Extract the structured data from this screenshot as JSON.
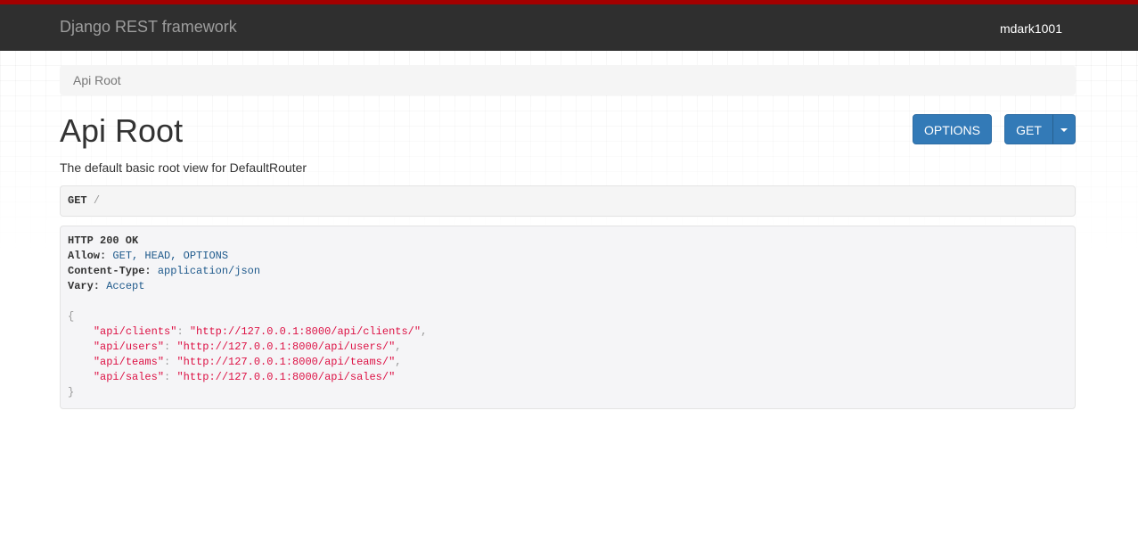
{
  "navbar": {
    "brand": "Django REST framework",
    "user": "mdark1001",
    "accent_color": "#a30000",
    "background": "#2f2f2f"
  },
  "breadcrumb": {
    "items": [
      "Api Root"
    ]
  },
  "page": {
    "title": "Api Root",
    "description": "The default basic root view for DefaultRouter"
  },
  "buttons": {
    "options_label": "OPTIONS",
    "get_label": "GET",
    "dropdown_icon": "caret-down-icon",
    "color": "#337ab7"
  },
  "request": {
    "method": "GET",
    "path": "/"
  },
  "response": {
    "status": "HTTP 200 OK",
    "headers": [
      {
        "key": "Allow:",
        "value": "GET, HEAD, OPTIONS"
      },
      {
        "key": "Content-Type:",
        "value": "application/json"
      },
      {
        "key": "Vary:",
        "value": "Accept"
      }
    ],
    "body_open": "{",
    "body_close": "}",
    "entries": [
      {
        "key": "\"api/clients\"",
        "value": "\"http://127.0.0.1:8000/api/clients/\"",
        "sep": ","
      },
      {
        "key": "\"api/users\"",
        "value": "\"http://127.0.0.1:8000/api/users/\"",
        "sep": ","
      },
      {
        "key": "\"api/teams\"",
        "value": "\"http://127.0.0.1:8000/api/teams/\"",
        "sep": ","
      },
      {
        "key": "\"api/sales\"",
        "value": "\"http://127.0.0.1:8000/api/sales/\"",
        "sep": ""
      }
    ]
  }
}
